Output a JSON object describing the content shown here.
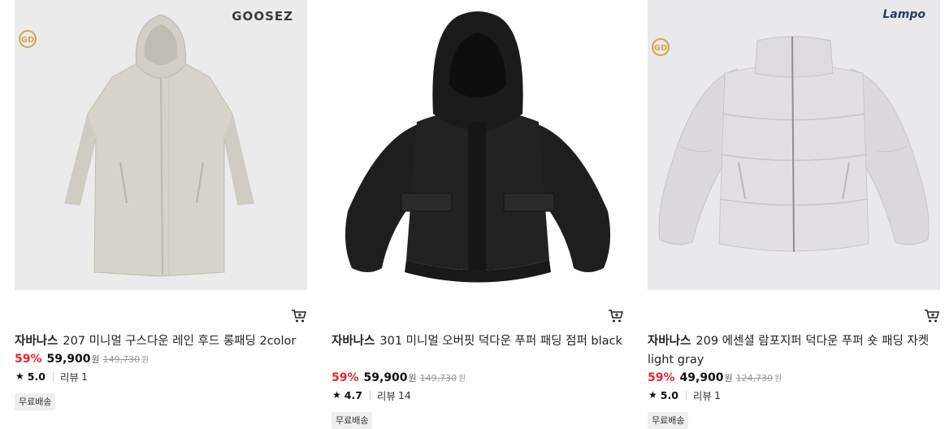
{
  "products": [
    {
      "brand_logo_text": "GOOSEZ",
      "badge_text": "GD",
      "brand": "자바나스",
      "name": "207 미니멀 구스다운 레인 후드 롱패딩 2color",
      "discount": "59%",
      "price": "59,900",
      "currency": "원",
      "original_price": "149,730",
      "rating": "5.0",
      "review_label": "리뷰",
      "review_count": "1",
      "shipping_badge": "무료배송",
      "image_icon": "long-hooded-coat-image"
    },
    {
      "brand": "자바나스",
      "name": "301 미니멀 오버핏 덕다운 푸퍼 패딩 점퍼 black",
      "discount": "59%",
      "price": "59,900",
      "currency": "원",
      "original_price": "149,730",
      "rating": "4.7",
      "review_label": "리뷰",
      "review_count": "14",
      "shipping_badge": "무료배송",
      "image_icon": "black-puffer-jacket-image"
    },
    {
      "brand_logo_text": "Lampo",
      "badge_text": "GD",
      "brand": "자바나스",
      "name": "209 에센셜 람포지퍼 덕다운 푸퍼 숏 패딩 자켓 light gray",
      "discount": "59%",
      "price": "49,900",
      "currency": "원",
      "original_price": "124,730",
      "rating": "5.0",
      "review_label": "리뷰",
      "review_count": "1",
      "shipping_badge": "무료배송",
      "image_icon": "light-gray-puffer-jacket-image"
    }
  ],
  "colors": {
    "discount": "#e8262b",
    "gold_badge": "#d1a84a",
    "thumb_bg_1": "#ebebeb",
    "thumb_bg_3": "#e9e8ea"
  }
}
